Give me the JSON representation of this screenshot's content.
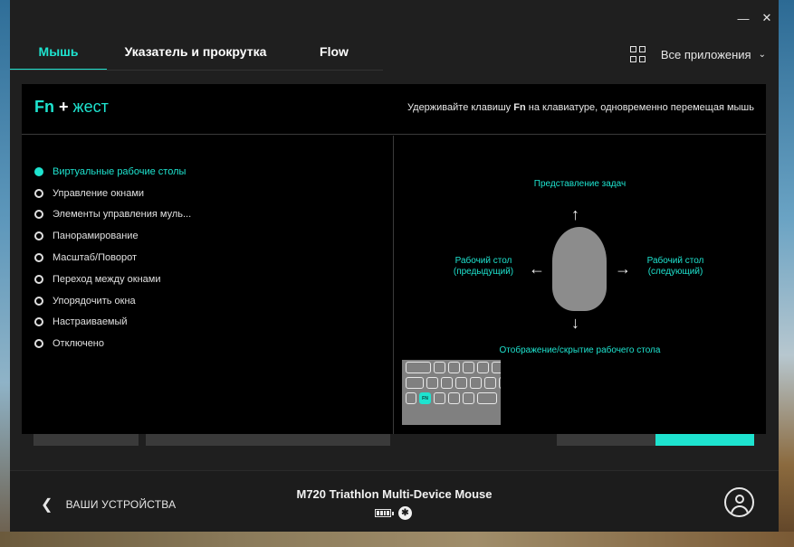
{
  "window": {
    "minimize_glyph": "—",
    "close_glyph": "✕"
  },
  "tabs": [
    {
      "label": "Мышь",
      "active": true
    },
    {
      "label": "Указатель и прокрутка",
      "active": false
    },
    {
      "label": "Flow",
      "active": false
    }
  ],
  "apps_select": {
    "label": "Все приложения",
    "icon": "grid-icon"
  },
  "panel": {
    "title_key": "Fn",
    "title_plus": "+",
    "title_rest": "жест",
    "hint_prefix": "Удерживайте клавишу",
    "hint_key": "Fn",
    "hint_suffix": "на клавиатуре, одновременно перемещая мышь"
  },
  "options": [
    {
      "label": "Виртуальные рабочие столы",
      "selected": true
    },
    {
      "label": "Управление окнами",
      "selected": false
    },
    {
      "label": "Элементы управления муль...",
      "selected": false
    },
    {
      "label": "Панорамирование",
      "selected": false
    },
    {
      "label": "Масштаб/Поворот",
      "selected": false
    },
    {
      "label": "Переход между окнами",
      "selected": false
    },
    {
      "label": "Упорядочить окна",
      "selected": false
    },
    {
      "label": "Настраиваемый",
      "selected": false
    },
    {
      "label": "Отключено",
      "selected": false
    }
  ],
  "gesture": {
    "up": "Представление задач",
    "left_line1": "Рабочий стол",
    "left_line2": "(предыдущий)",
    "right_line1": "Рабочий стол",
    "right_line2": "(следующий)",
    "down": "Отображение/скрытие рабочего стола",
    "fn_key_label": "FN"
  },
  "footer": {
    "back_label": "ВАШИ УСТРОЙСТВА",
    "device_name": "M720 Triathlon Multi-Device Mouse",
    "battery_icon": "battery-icon",
    "connection_icon": "bluetooth-icon"
  },
  "colors": {
    "accent": "#1ee3cf",
    "window_bg": "#1f1f1f",
    "panel_bg": "#000000"
  }
}
